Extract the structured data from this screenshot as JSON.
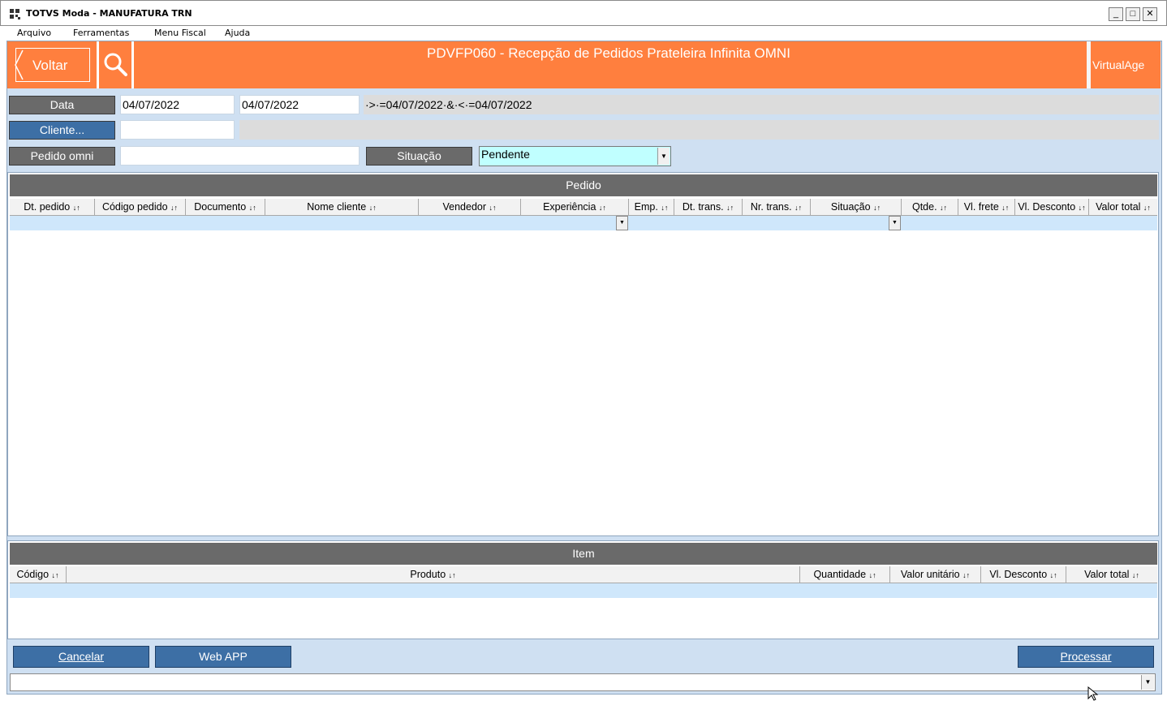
{
  "window": {
    "title": "TOTVS Moda - MANUFATURA TRN",
    "controls": {
      "minimize": "_",
      "maximize": "□",
      "close": "✕"
    }
  },
  "menu": [
    "Arquivo",
    "Ferramentas",
    "Menu Fiscal",
    "Ajuda"
  ],
  "header": {
    "back_label": "Voltar",
    "title": "PDVFP060 - Recepção de Pedidos Prateleira Infinita OMNI",
    "brand": "VirtualAge",
    "color": "#ff7f3e"
  },
  "filters": {
    "data_label": "Data",
    "date_from": "04/07/2022",
    "date_to": "04/07/2022",
    "date_expr": "·>·=04/07/2022·&·<·=04/07/2022",
    "cliente_label": "Cliente...",
    "cliente_value": "",
    "pedido_label": "Pedido omni",
    "pedido_value": "",
    "situacao_label": "Situação",
    "situacao_value": "Pendente"
  },
  "pedido_grid": {
    "title": "Pedido",
    "columns": [
      "Dt. pedido",
      "Código pedido",
      "Documento",
      "Nome cliente",
      "Vendedor",
      "Experiência",
      "Emp.",
      "Dt. trans.",
      "Nr. trans.",
      "Situação",
      "Qtde.",
      "Vl. frete",
      "Vl. Desconto",
      "Valor total"
    ]
  },
  "item_grid": {
    "title": "Item",
    "columns": [
      "Código",
      "Produto",
      "Quantidade",
      "Valor unitário",
      "Vl. Desconto",
      "Valor total"
    ]
  },
  "buttons": {
    "cancelar": "Cancelar",
    "webapp": "Web APP",
    "processar": "Processar"
  },
  "sort_glyph": "↓↑",
  "icons": [
    "app-icon",
    "search-icon",
    "chevron-left-icon",
    "dropdown-arrow-icon"
  ],
  "colors": {
    "accent": "#ff7f3e",
    "blue_button": "#3d6fa5",
    "grey_label": "#6a6a6a",
    "combo_bg": "#c0ffff",
    "panel_bg": "#cfe0f2"
  }
}
